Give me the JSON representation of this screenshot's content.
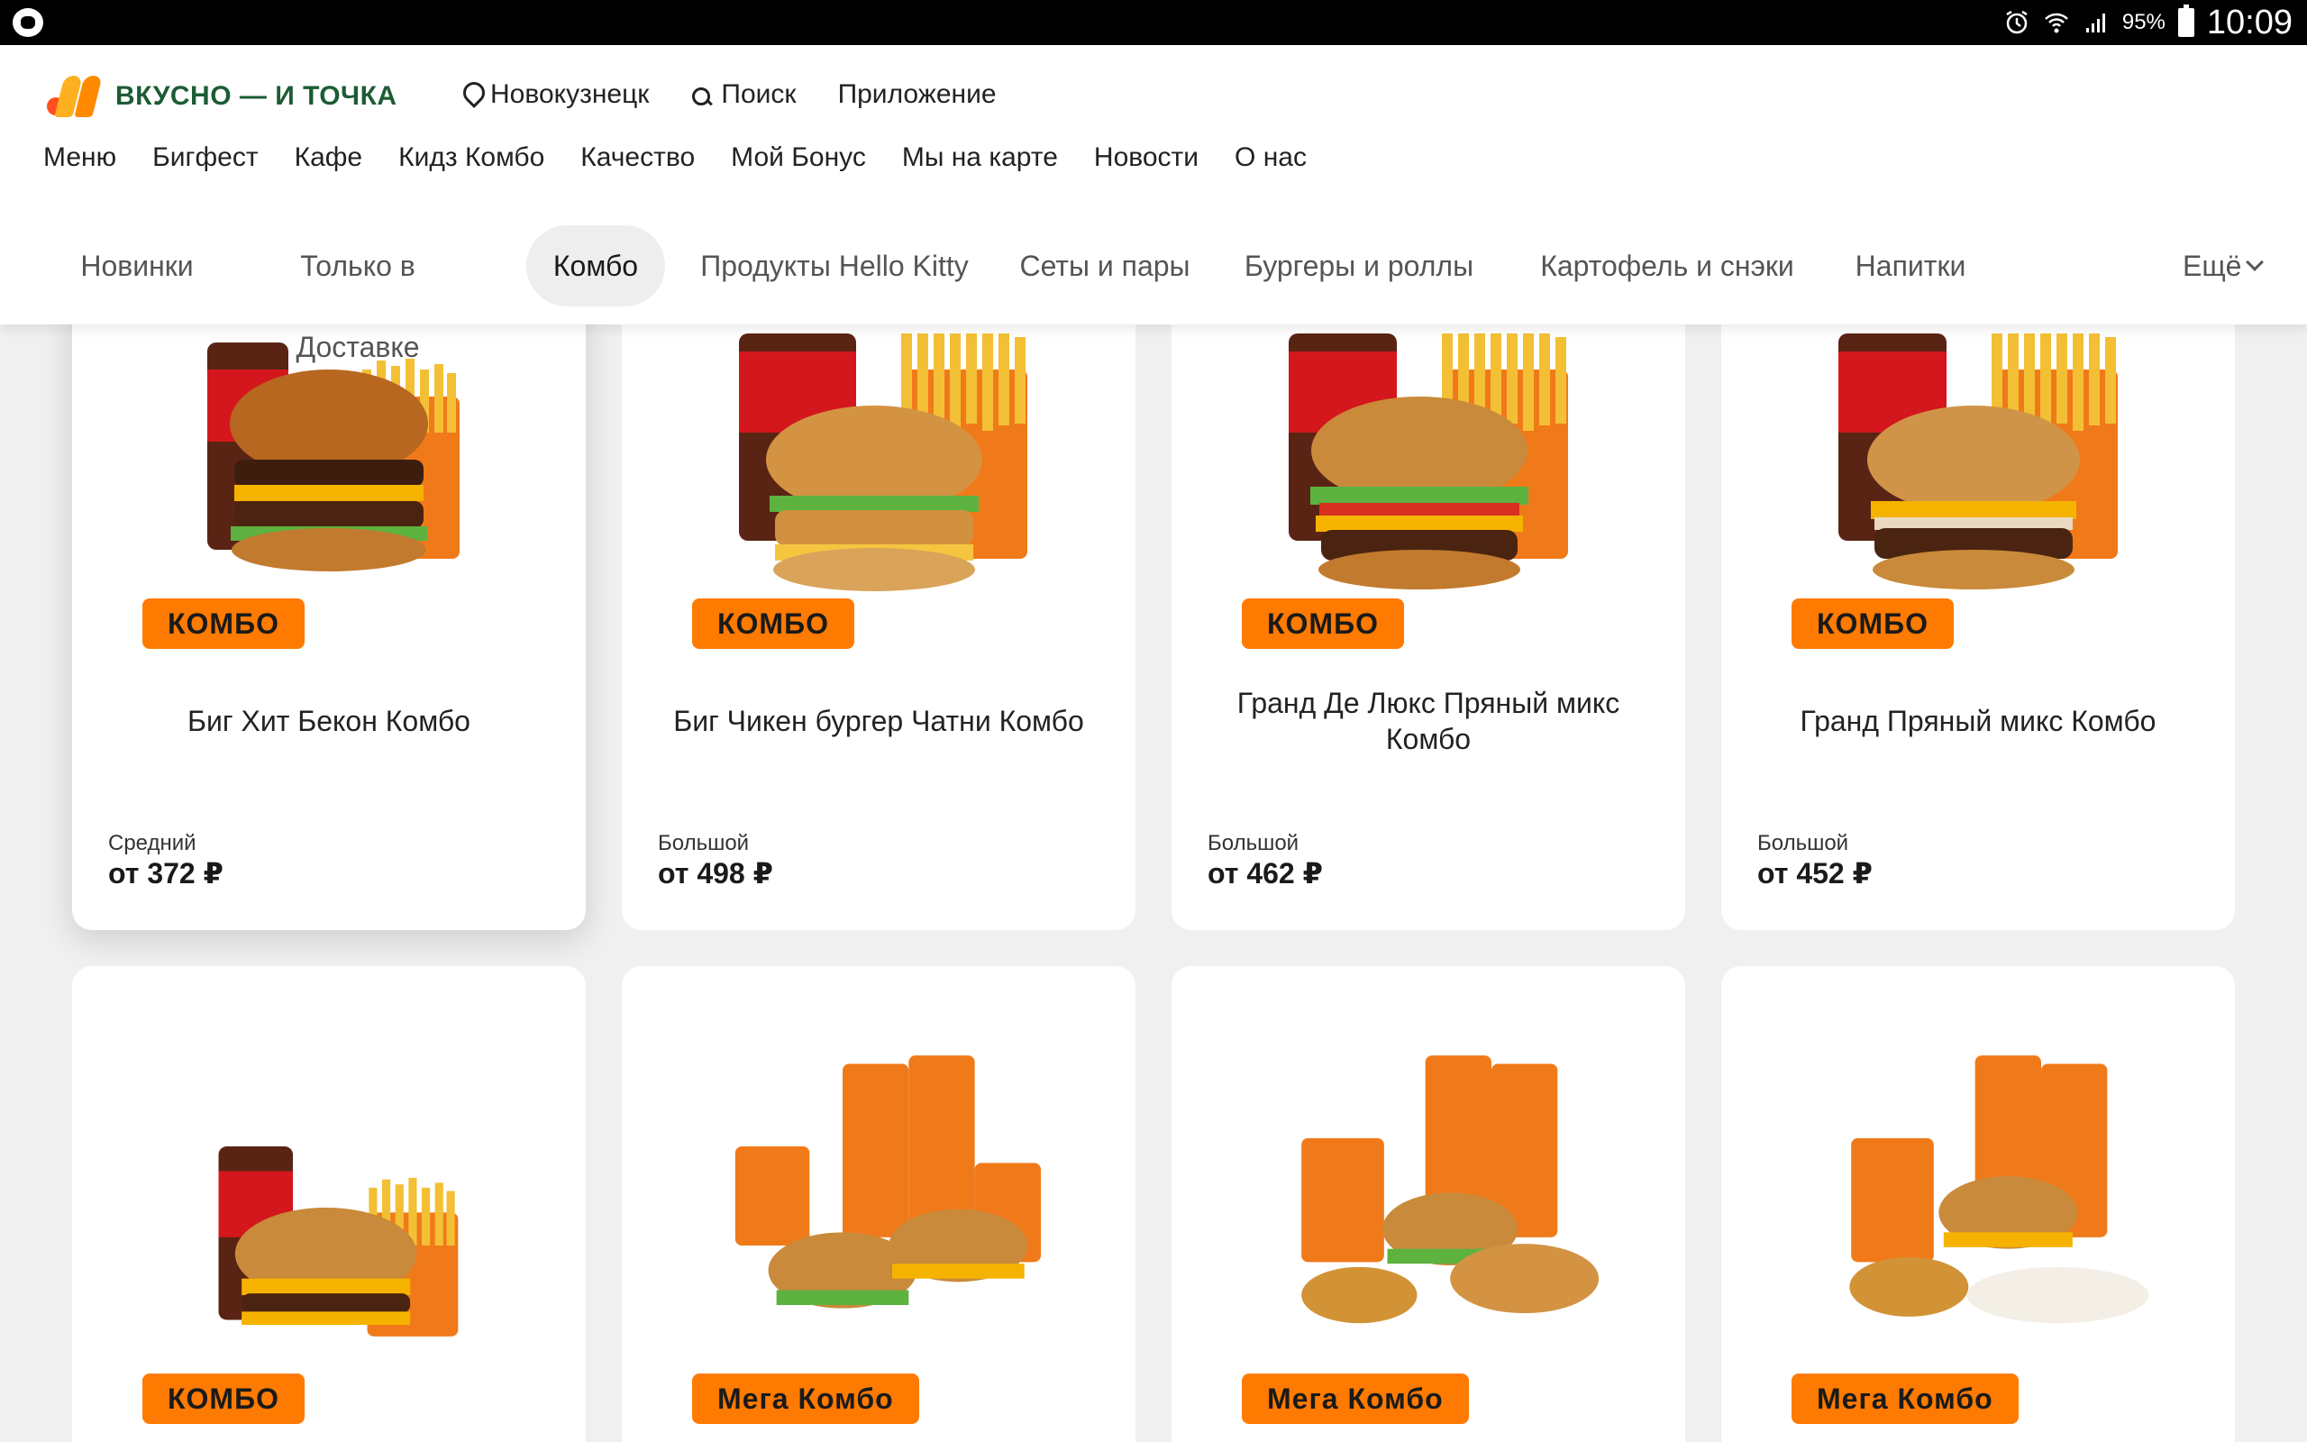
{
  "status_bar": {
    "battery": "95%",
    "time": "10:09"
  },
  "brand": {
    "logo_text": "ВКУСНО — И ТОЧКА"
  },
  "top_nav": {
    "city": "Новокузнецк",
    "search": "Поиск",
    "app": "Приложение"
  },
  "main_nav": [
    "Меню",
    "Бигфест",
    "Кафе",
    "Кидз Комбо",
    "Качество",
    "Мой Бонус",
    "Мы на карте",
    "Новости",
    "О нас"
  ],
  "category_tabs": [
    "Новинки",
    "Только в Доставке",
    "Комбо",
    "Продукты Hello Kitty",
    "Сеты и пары",
    "Бургеры и роллы",
    "Картофель и снэки",
    "Напитки"
  ],
  "active_tab": "Комбо",
  "more_label": "Ещё",
  "products_row1": [
    {
      "badge": "КОМБО",
      "name": "Биг Хит Бекон Комбо",
      "size": "Средний",
      "price": "от 372 ₽"
    },
    {
      "badge": "КОМБО",
      "name": "Биг Чикен бургер Чатни Комбо",
      "size": "Большой",
      "price": "от 498 ₽"
    },
    {
      "badge": "КОМБО",
      "name": "Гранд Де Люкс Пряный микс Комбо",
      "size": "Большой",
      "price": "от 462 ₽"
    },
    {
      "badge": "КОМБО",
      "name": "Гранд Пряный микс Комбо",
      "size": "Большой",
      "price": "от 452 ₽"
    }
  ],
  "products_row2": [
    {
      "badge": "КОМБО"
    },
    {
      "badge": "Мега Комбо"
    },
    {
      "badge": "Мега Комбо"
    },
    {
      "badge": "Мега Комбо"
    }
  ],
  "colors": {
    "accent": "#ff7a00",
    "brand_green": "#1c5c34",
    "logo_red": "#ff4f1f",
    "logo_yellow": "#ffb020"
  }
}
